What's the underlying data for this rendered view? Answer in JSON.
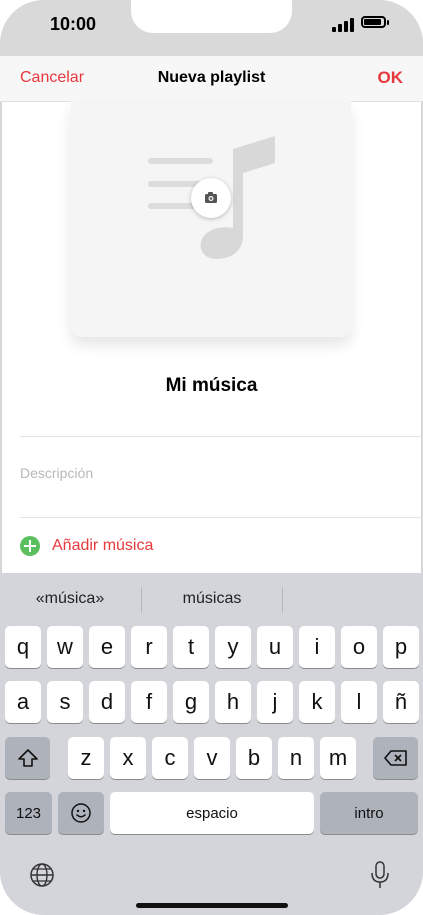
{
  "status": {
    "time": "10:00"
  },
  "nav": {
    "cancel_label": "Cancelar",
    "title": "Nueva playlist",
    "ok_label": "OK"
  },
  "playlist": {
    "name": "Mi música",
    "description_placeholder": "Descripción",
    "add_music_label": "Añadir música"
  },
  "keyboard": {
    "suggestions": [
      "«música»",
      "músicas"
    ],
    "row1": [
      "q",
      "w",
      "e",
      "r",
      "t",
      "y",
      "u",
      "i",
      "o",
      "p"
    ],
    "row2": [
      "a",
      "s",
      "d",
      "f",
      "g",
      "h",
      "j",
      "k",
      "l",
      "ñ"
    ],
    "row3": [
      "z",
      "x",
      "c",
      "v",
      "b",
      "n",
      "m"
    ],
    "numbers_label": "123",
    "space_label": "espacio",
    "return_label": "intro"
  },
  "colors": {
    "accent": "#e6393d",
    "add_icon": "#5bbf5f",
    "keyboard_bg": "#d3d5db"
  },
  "icons": [
    "signal-icon",
    "battery-icon",
    "music-note-icon",
    "camera-icon",
    "add-icon",
    "shift-icon",
    "delete-icon",
    "emoji-icon",
    "globe-icon",
    "microphone-icon"
  ]
}
